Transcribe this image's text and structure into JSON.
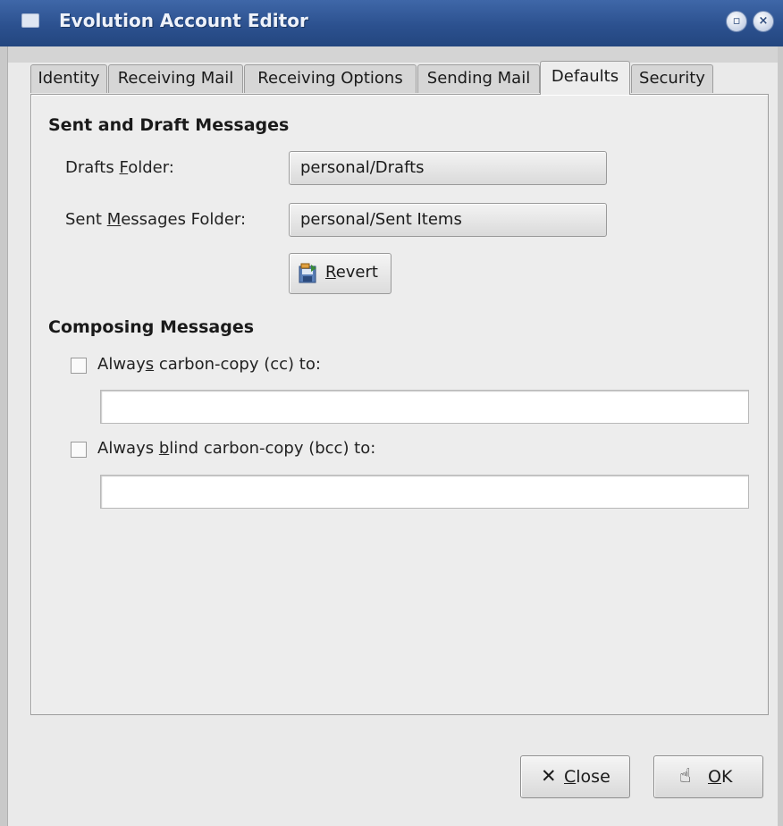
{
  "window": {
    "title": "Evolution Account Editor"
  },
  "tabs": [
    {
      "label": "Identity"
    },
    {
      "label": "Receiving Mail"
    },
    {
      "label": "Receiving Options"
    },
    {
      "label": "Sending Mail"
    },
    {
      "label": "Defaults",
      "active": true
    },
    {
      "label": "Security"
    }
  ],
  "sent_draft": {
    "heading": "Sent and Draft Messages",
    "drafts_label": {
      "pre": "Drafts ",
      "mnemonic": "F",
      "post": "older:"
    },
    "drafts_value": "personal/Drafts",
    "sent_label": {
      "pre": "Sent ",
      "mnemonic": "M",
      "post": "essages Folder:"
    },
    "sent_value": "personal/Sent Items",
    "revert_label": {
      "mnemonic": "R",
      "post": "evert"
    },
    "revert_icon": "revert-icon"
  },
  "composing": {
    "heading": "Composing Messages",
    "cc": {
      "pre": "Alway",
      "mnemonic": "s",
      "post": " carbon-copy (cc) to:",
      "checked": false,
      "value": ""
    },
    "bcc": {
      "pre": "Always ",
      "mnemonic": "b",
      "post": "lind carbon-copy (bcc) to:",
      "checked": false,
      "value": ""
    }
  },
  "buttons": {
    "close": {
      "mnemonic": "C",
      "post": "lose",
      "icon": "close-x-icon"
    },
    "ok": {
      "mnemonic": "O",
      "post": "K",
      "icon": "ok-hand-icon"
    }
  }
}
